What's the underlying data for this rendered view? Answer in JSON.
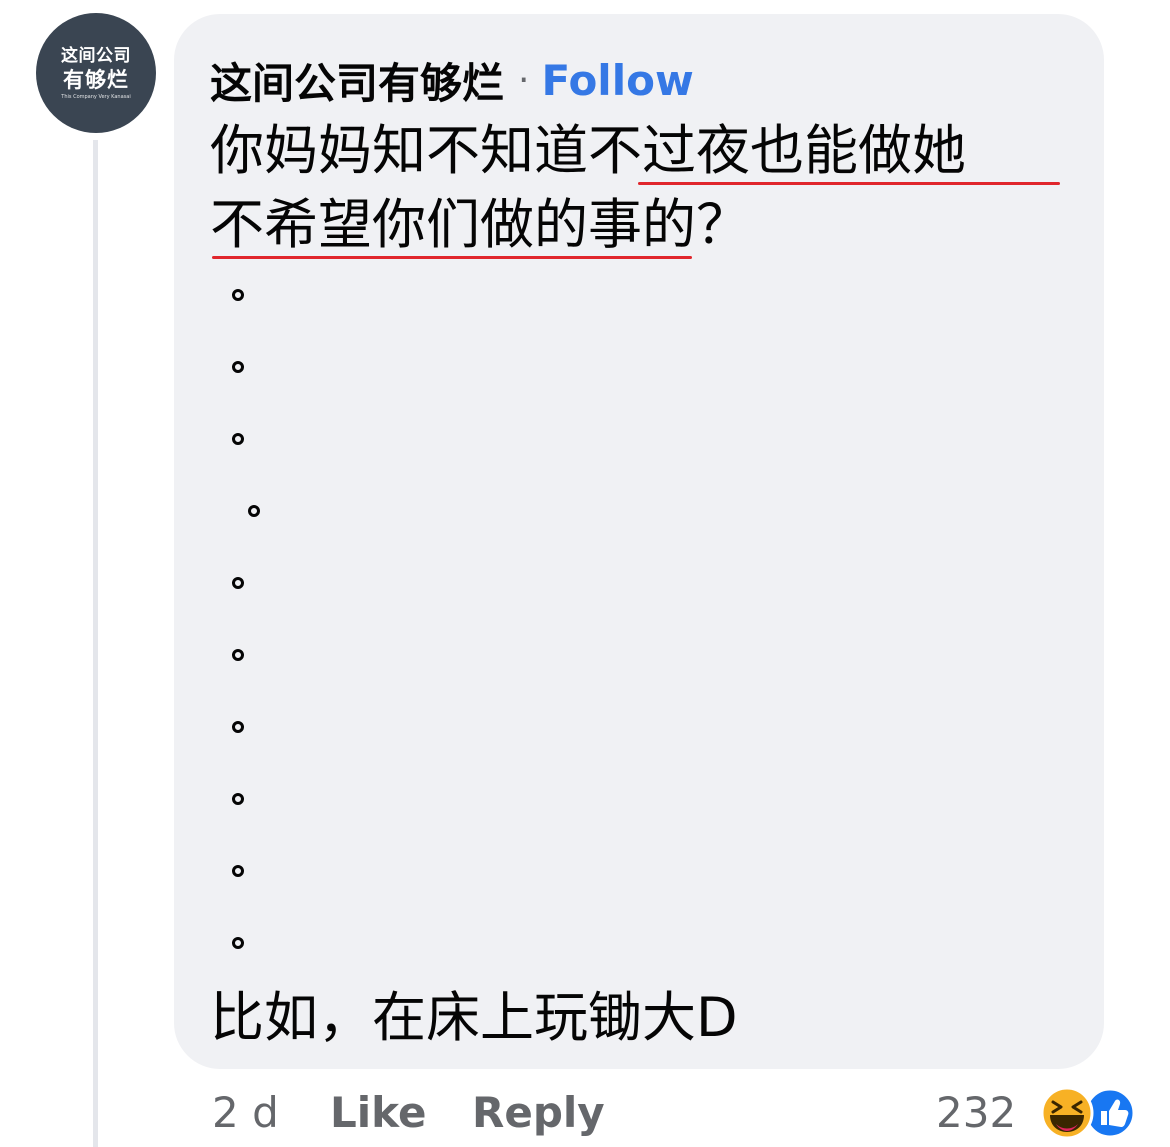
{
  "avatar": {
    "line1": "这间公司",
    "line2": "有够烂",
    "line3": "This Company Very Kanasai"
  },
  "comment": {
    "author": "这间公司有够烂",
    "separator": "·",
    "follow_label": "Follow",
    "line1": "你妈妈知不知道不过夜也能做她",
    "line2": "不希望你们做的事的？",
    "line_last": "比如，在床上玩锄大D",
    "period_count": 10
  },
  "footer": {
    "time": "2 d",
    "like_label": "Like",
    "reply_label": "Reply",
    "reaction_count": "232",
    "reaction_icons": [
      "laughing-emoji-icon",
      "thumbs-up-icon"
    ]
  },
  "colors": {
    "bubble": "#f0f1f4",
    "follow": "#3578e5",
    "underline": "#e0262c",
    "like_blue": "#1877f2",
    "haha_yellow": "#f7b125"
  }
}
